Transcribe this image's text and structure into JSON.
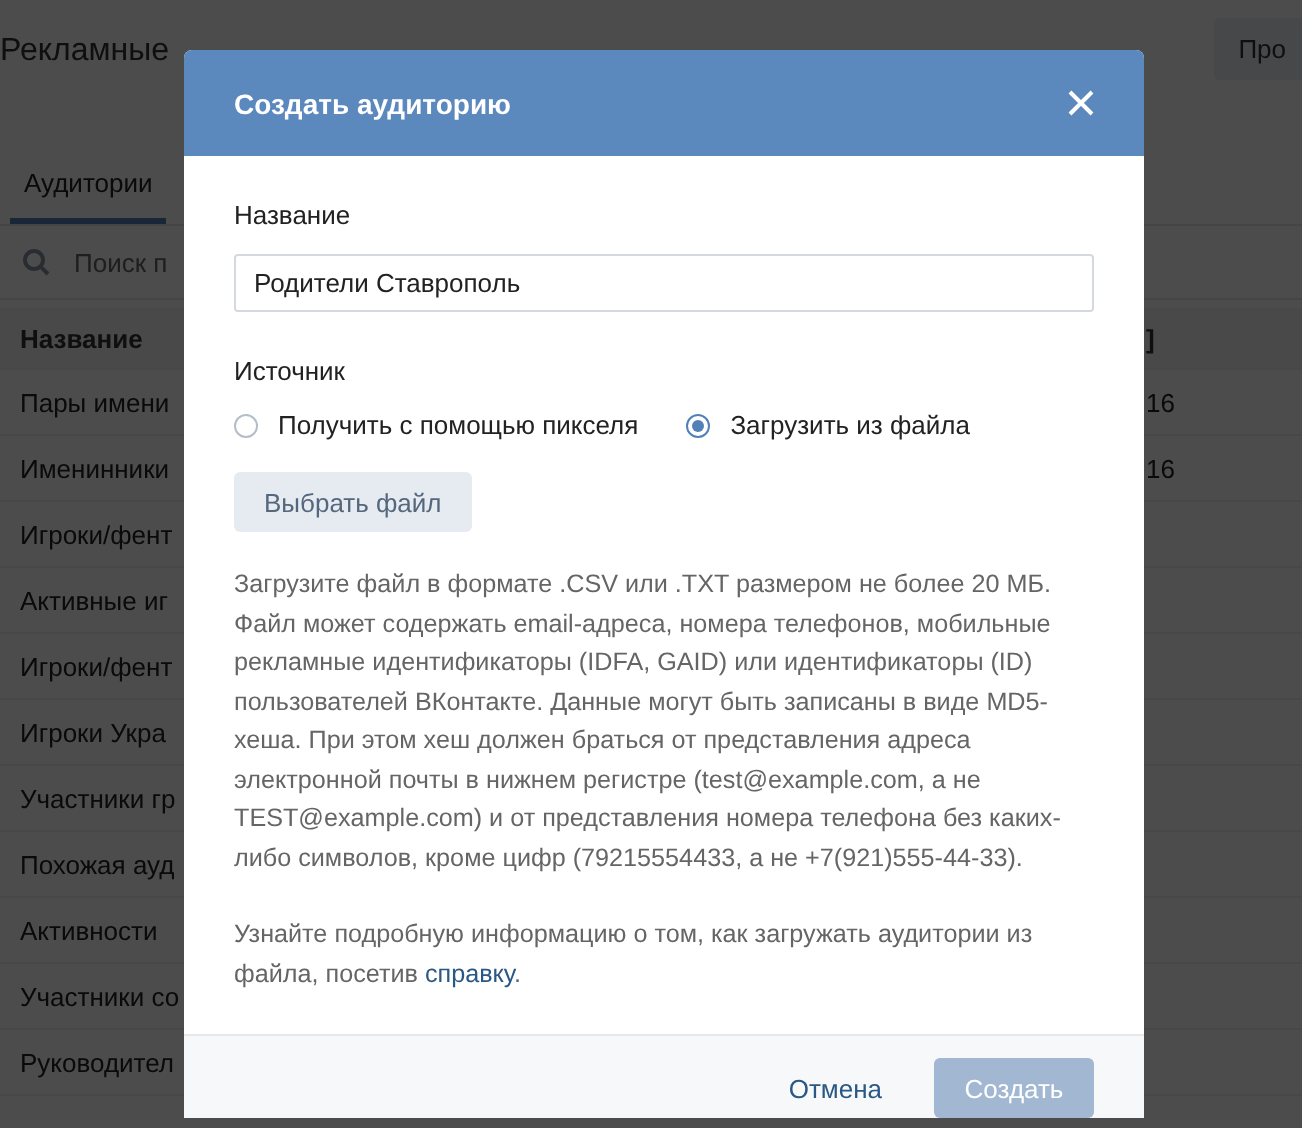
{
  "page": {
    "breadcrumb": "Рекламные",
    "top_button": "Про",
    "tabs": [
      {
        "label": "Аудитории",
        "selected": true
      }
    ],
    "search": {
      "placeholder": "Поиск п"
    },
    "table": {
      "header": {
        "column_1": "Название",
        "column_2": "]"
      },
      "rows": [
        {
          "column_1": "Пары имени",
          "column_2": "16"
        },
        {
          "column_1": "Именинники",
          "column_2": "16"
        },
        {
          "column_1": "Игроки/фент"
        },
        {
          "column_1": "Активные иг"
        },
        {
          "column_1": "Игроки/фент"
        },
        {
          "column_1": "Игроки Укра"
        },
        {
          "column_1": "Участники гр"
        },
        {
          "column_1": "Похожая ауд"
        },
        {
          "column_1": "Активности"
        },
        {
          "column_1": "Участники со"
        },
        {
          "column_1": "Руководител"
        }
      ]
    }
  },
  "dialog": {
    "title": "Создать аудиторию",
    "name_label": "Название",
    "name_value": "Родители Ставрополь",
    "source_label": "Источник",
    "sources": [
      {
        "label": "Получить с помощью пикселя",
        "selected": false
      },
      {
        "label": "Загрузить из файла",
        "selected": true
      }
    ],
    "choose_file_button": "Выбрать файл",
    "description": "Загрузите файл в формате .CSV или .TXT размером не более 20 МБ. Файл может содержать email-адреса, номера телефонов, мобильные рекламные идентификаторы (IDFA, GAID) или идентификаторы (ID) пользователей ВКонтакте. Данные могут быть записаны в виде MD5-хеша. При этом хеш должен браться от представления адреса электронной почты в нижнем регистре (test@example.com, а не TEST@example.com) и от представления номера телефона без каких-либо символов, кроме цифр (79215554433, а не +7(921)555-44-33).",
    "help": {
      "text": "Узнайте подробную информацию о том, как загружать аудитории из файла, посетив",
      "link": "справку",
      "end": "."
    },
    "cancel_button": "Отмена",
    "create_button": {
      "label": "Создать",
      "disabled": true
    }
  }
}
